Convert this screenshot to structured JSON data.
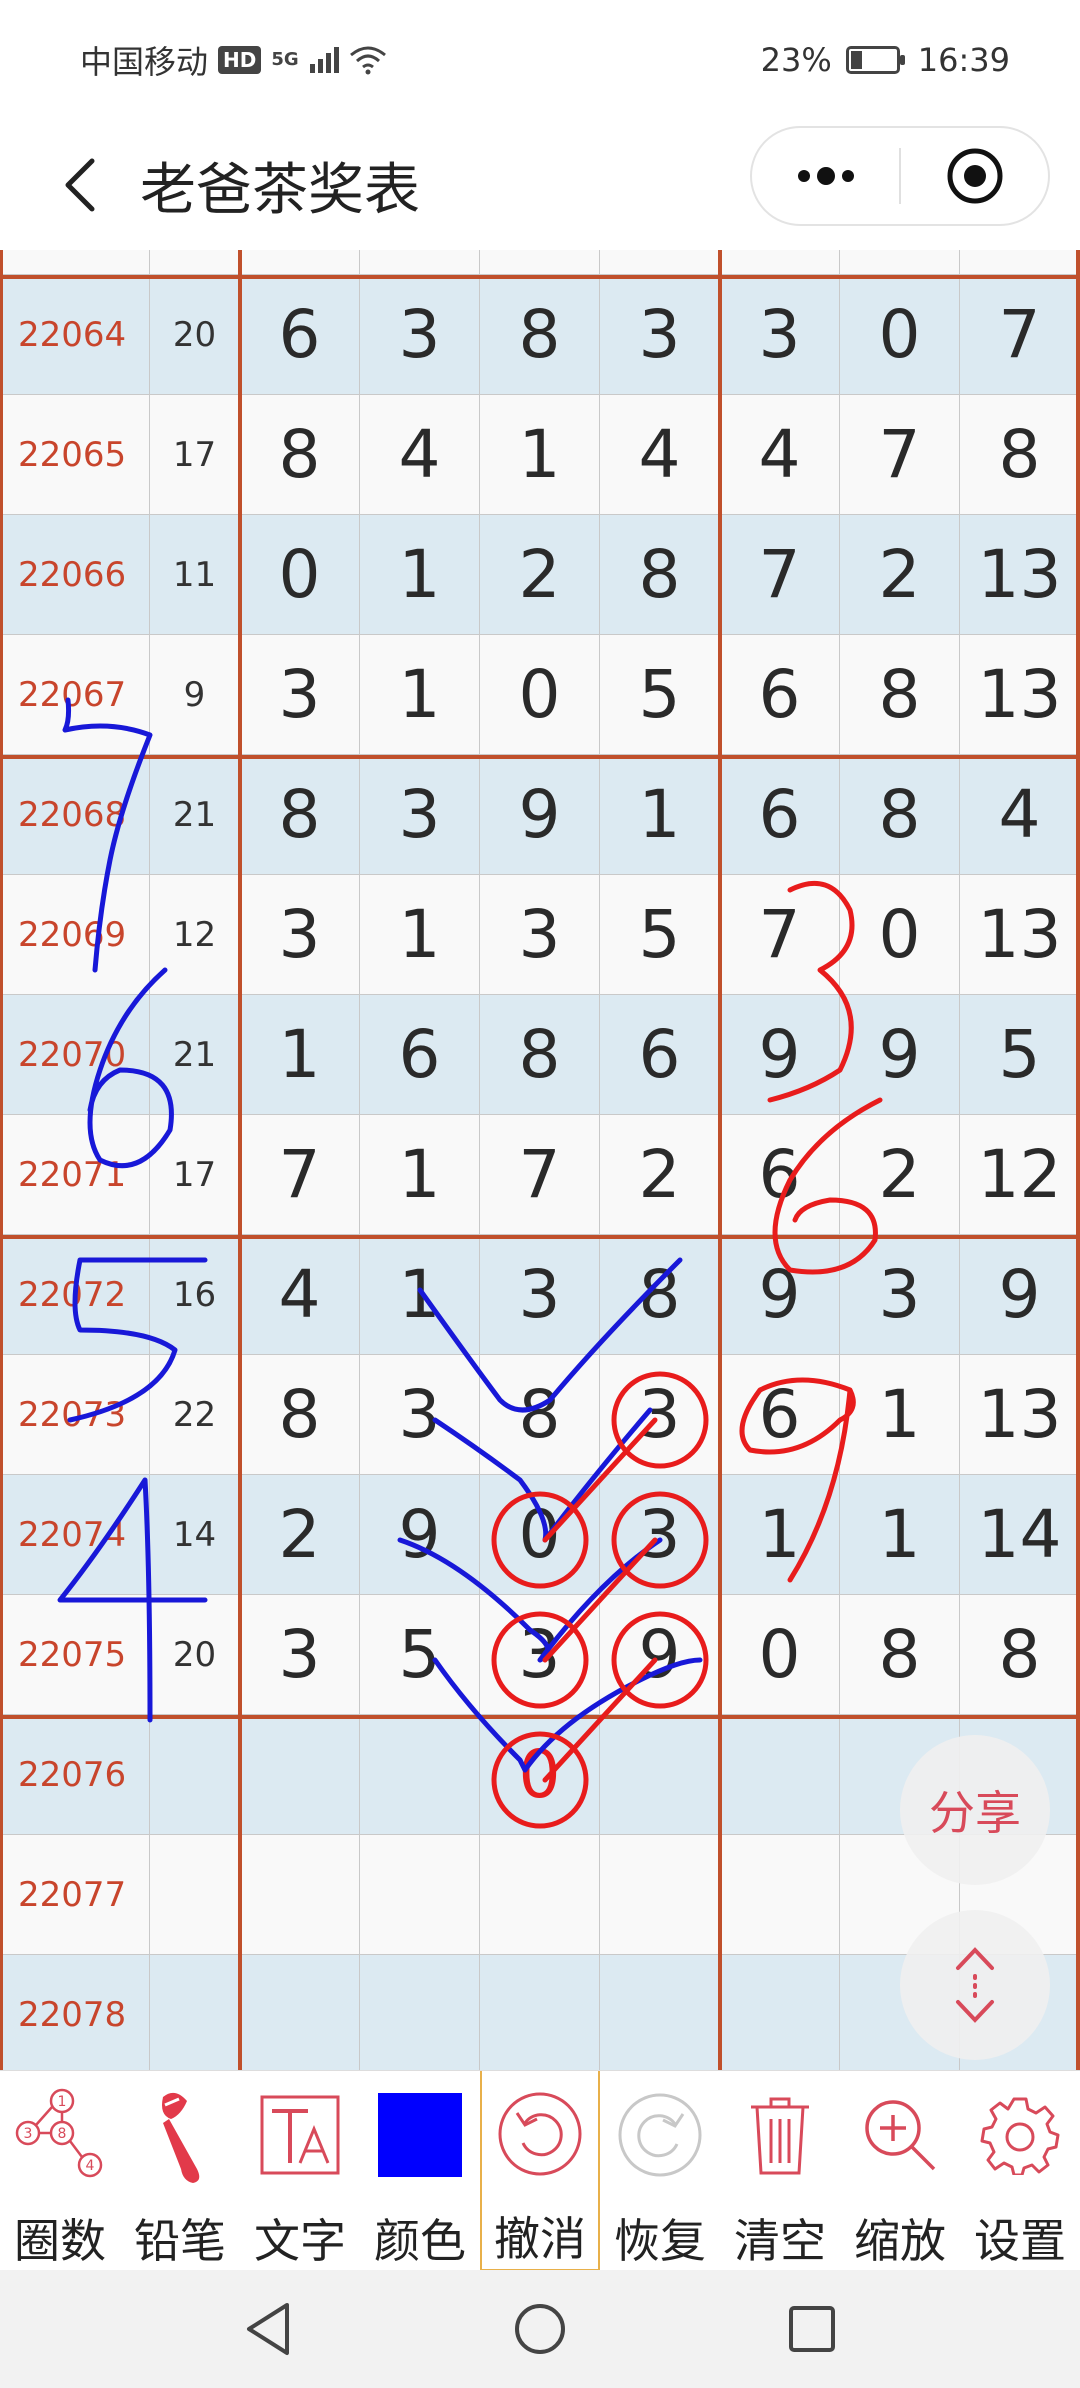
{
  "status_bar": {
    "carrier": "中国移动",
    "hd": "HD",
    "net": "5G",
    "battery_pct": "23%",
    "battery_level": 0.23,
    "time": "16:39"
  },
  "nav": {
    "title": "老爸茶奖表"
  },
  "rows": [
    {
      "issue": "22064",
      "sum": "20",
      "nums": [
        "6",
        "3",
        "8",
        "3",
        "3",
        "0",
        "7"
      ]
    },
    {
      "issue": "22065",
      "sum": "17",
      "nums": [
        "8",
        "4",
        "1",
        "4",
        "4",
        "7",
        "8"
      ]
    },
    {
      "issue": "22066",
      "sum": "11",
      "nums": [
        "0",
        "1",
        "2",
        "8",
        "7",
        "2",
        "13"
      ]
    },
    {
      "issue": "22067",
      "sum": "9",
      "nums": [
        "3",
        "1",
        "0",
        "5",
        "6",
        "8",
        "13"
      ]
    },
    {
      "issue": "22068",
      "sum": "21",
      "nums": [
        "8",
        "3",
        "9",
        "1",
        "6",
        "8",
        "4"
      ]
    },
    {
      "issue": "22069",
      "sum": "12",
      "nums": [
        "3",
        "1",
        "3",
        "5",
        "7",
        "0",
        "13"
      ]
    },
    {
      "issue": "22070",
      "sum": "21",
      "nums": [
        "1",
        "6",
        "8",
        "6",
        "9",
        "9",
        "5"
      ]
    },
    {
      "issue": "22071",
      "sum": "17",
      "nums": [
        "7",
        "1",
        "7",
        "2",
        "6",
        "2",
        "12"
      ]
    },
    {
      "issue": "22072",
      "sum": "16",
      "nums": [
        "4",
        "1",
        "3",
        "8",
        "9",
        "3",
        "9"
      ]
    },
    {
      "issue": "22073",
      "sum": "22",
      "nums": [
        "8",
        "3",
        "8",
        "3",
        "6",
        "1",
        "13"
      ]
    },
    {
      "issue": "22074",
      "sum": "14",
      "nums": [
        "2",
        "9",
        "0",
        "3",
        "1",
        "1",
        "14"
      ]
    },
    {
      "issue": "22075",
      "sum": "20",
      "nums": [
        "3",
        "5",
        "3",
        "9",
        "0",
        "8",
        "8"
      ]
    },
    {
      "issue": "22076",
      "sum": "",
      "nums": [
        "",
        "",
        "0",
        "",
        "",
        "",
        ""
      ]
    },
    {
      "issue": "22077",
      "sum": "",
      "nums": [
        "",
        "",
        "",
        "",
        "",
        "",
        ""
      ]
    },
    {
      "issue": "22078",
      "sum": "",
      "nums": [
        "",
        "",
        "",
        "",
        "",
        "",
        ""
      ]
    }
  ],
  "float_buttons": {
    "share": "分享"
  },
  "toolbar": [
    {
      "label": "圈数",
      "icon": "circle-numbers-icon"
    },
    {
      "label": "铅笔",
      "icon": "brush-icon"
    },
    {
      "label": "文字",
      "icon": "text-icon"
    },
    {
      "label": "颜色",
      "icon": "color-swatch-icon"
    },
    {
      "label": "撤消",
      "icon": "undo-icon"
    },
    {
      "label": "恢复",
      "icon": "redo-icon"
    },
    {
      "label": "清空",
      "icon": "trash-icon"
    },
    {
      "label": "缩放",
      "icon": "zoom-in-icon"
    },
    {
      "label": "设置",
      "icon": "gear-icon"
    }
  ],
  "colors": {
    "accent_red": "#d84a5a",
    "divider": "#c0502c",
    "swatch": "#0000ff",
    "row_alt": "#dceaf2"
  }
}
